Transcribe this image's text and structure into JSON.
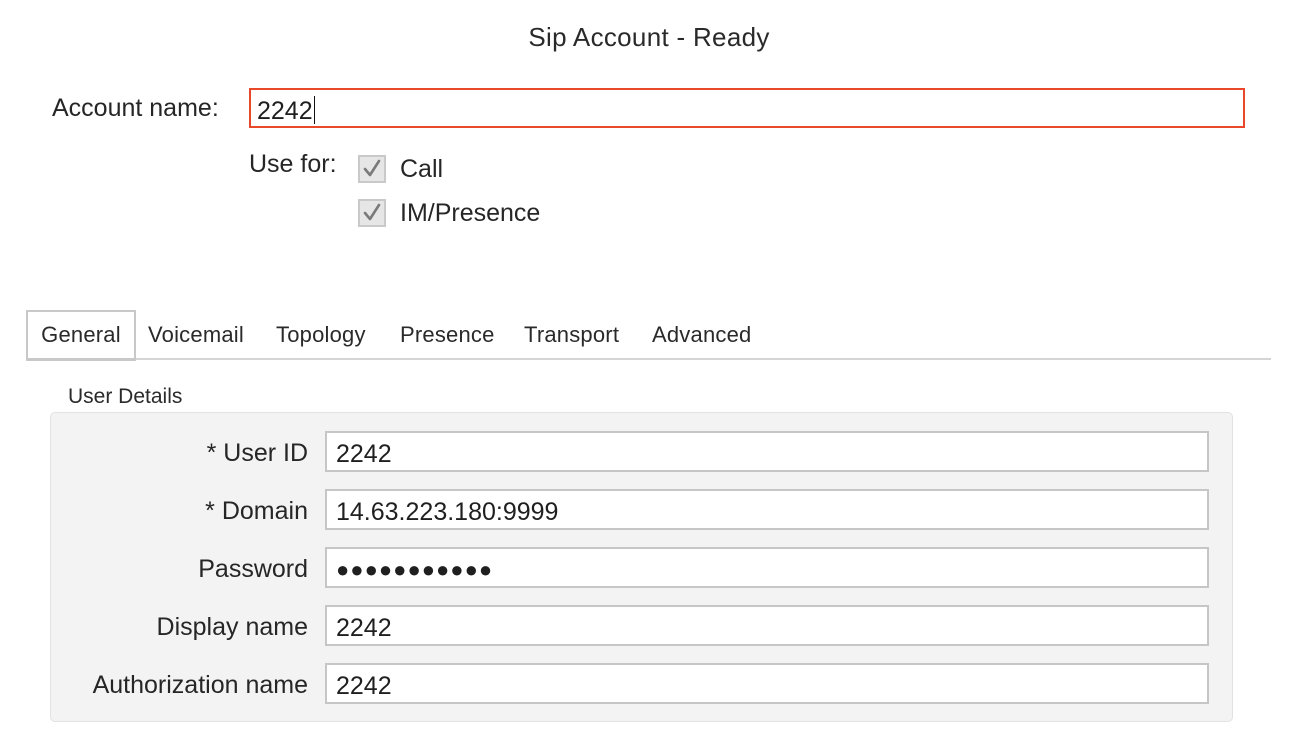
{
  "window": {
    "title": "Sip Account - Ready"
  },
  "account": {
    "label": "Account name:",
    "value": "2242"
  },
  "use_for": {
    "label": "Use for:",
    "options": [
      {
        "label": "Call",
        "checked": true
      },
      {
        "label": "IM/Presence",
        "checked": true
      }
    ]
  },
  "tabs": [
    {
      "label": "General",
      "active": true
    },
    {
      "label": "Voicemail",
      "active": false
    },
    {
      "label": "Topology",
      "active": false
    },
    {
      "label": "Presence",
      "active": false
    },
    {
      "label": "Transport",
      "active": false
    },
    {
      "label": "Advanced",
      "active": false
    }
  ],
  "user_details": {
    "group_label": "User Details",
    "fields": {
      "user_id": {
        "label": "* User ID",
        "value": "2242"
      },
      "domain": {
        "label": "* Domain",
        "value": "14.63.223.180:9999"
      },
      "password": {
        "label": "Password",
        "value": "●●●●●●●●●●●"
      },
      "display_name": {
        "label": "Display name",
        "value": "2242"
      },
      "authorization_name": {
        "label": "Authorization name",
        "value": "2242"
      }
    }
  },
  "colors": {
    "focus_border": "#e8492a",
    "panel_background": "#f3f3f3",
    "checkbox_fill": "#e6e6e6"
  }
}
